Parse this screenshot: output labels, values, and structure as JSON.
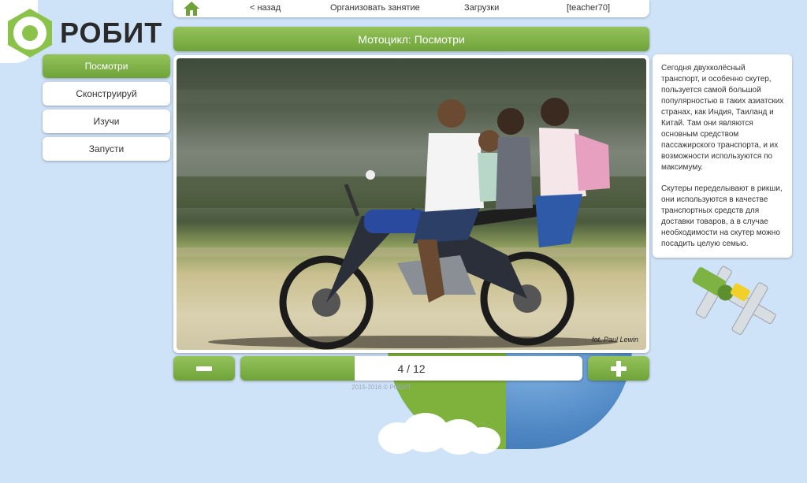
{
  "logo": {
    "text": "РОБИТ"
  },
  "nav": {
    "back": "< назад",
    "organize": "Организовать занятие",
    "downloads": "Загрузки",
    "user": "[teacher70]"
  },
  "menu": {
    "items": [
      {
        "label": "Посмотри",
        "active": true
      },
      {
        "label": "Сконструируй",
        "active": false
      },
      {
        "label": "Изучи",
        "active": false
      },
      {
        "label": "Запусти",
        "active": false
      }
    ]
  },
  "title": "Мотоцикл: Посмотри",
  "photo": {
    "credit": "fot. Paul Lewin"
  },
  "pager": {
    "minus": "−",
    "plus": "+",
    "label": "4 / 12",
    "current": 4,
    "total": 12
  },
  "footer": "2015-2016 © РОБИТ",
  "description": {
    "paragraphs": [
      "Сегодня двухколёсный транспорт, и особенно скутер, пользуется самой большой популярностью в таких азиатских странах, как Индия, Таиланд и Китай. Там они являются основным средством пассажирского транспорта, и их возможности используются по максимуму.",
      "Скутеры переделывают в рикши, они используются в качестве транспортных средств для доставки товаров, а в случае необходимости на скутер можно посадить целую семью."
    ]
  },
  "colors": {
    "accent_green": "#7cb342",
    "background": "#cfe3f8"
  }
}
